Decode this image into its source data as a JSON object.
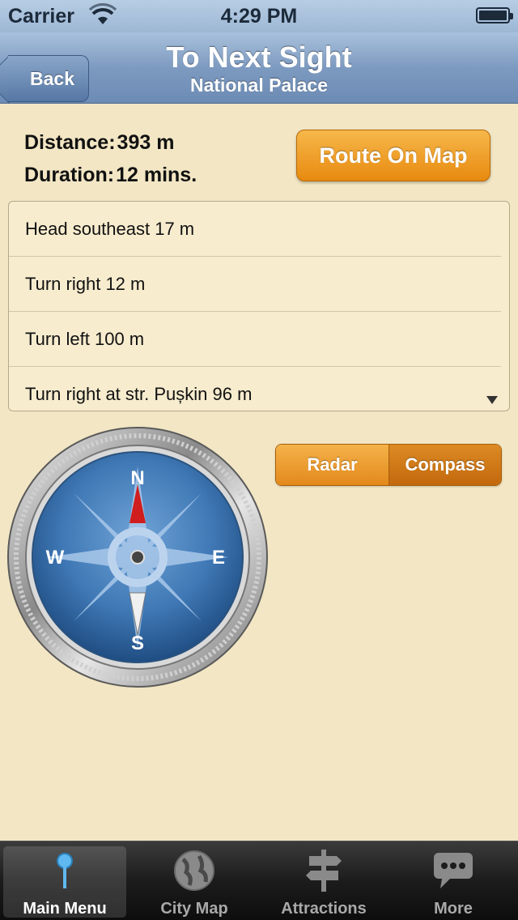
{
  "status_bar": {
    "carrier": "Carrier",
    "time": "4:29 PM",
    "wifi_icon": "wifi-icon",
    "battery_icon": "battery-icon",
    "battery_level": 1.0
  },
  "nav": {
    "back_label": "Back",
    "title": "To Next Sight",
    "subtitle": "National Palace"
  },
  "summary": {
    "distance_label": "Distance:",
    "distance_value": "393 m",
    "duration_label": "Duration:",
    "duration_value": "12 mins."
  },
  "route_button_label": "Route On Map",
  "directions": [
    {
      "text": "Head southeast 17 m"
    },
    {
      "text": "Turn right 12 m"
    },
    {
      "text": "Turn left 100 m"
    },
    {
      "text": "Turn right at str. Pușkin 96 m"
    }
  ],
  "segmented": {
    "radar_label": "Radar",
    "compass_label": "Compass",
    "selected": "Compass"
  },
  "compass": {
    "n": "N",
    "e": "E",
    "s": "S",
    "w": "W",
    "heading_degrees": 0
  },
  "tab_bar": {
    "items": [
      {
        "label": "Main Menu",
        "icon": "pin-icon",
        "active": true
      },
      {
        "label": "City Map",
        "icon": "globe-icon",
        "active": false
      },
      {
        "label": "Attractions",
        "icon": "signpost-icon",
        "active": false
      },
      {
        "label": "More",
        "icon": "chat-bubble-icon",
        "active": false
      }
    ]
  },
  "colors": {
    "background": "#f2e6c4",
    "nav_bar": "#7d9ac0",
    "accent_orange": "#e78a10",
    "tab_bar": "#1c1c1c"
  }
}
